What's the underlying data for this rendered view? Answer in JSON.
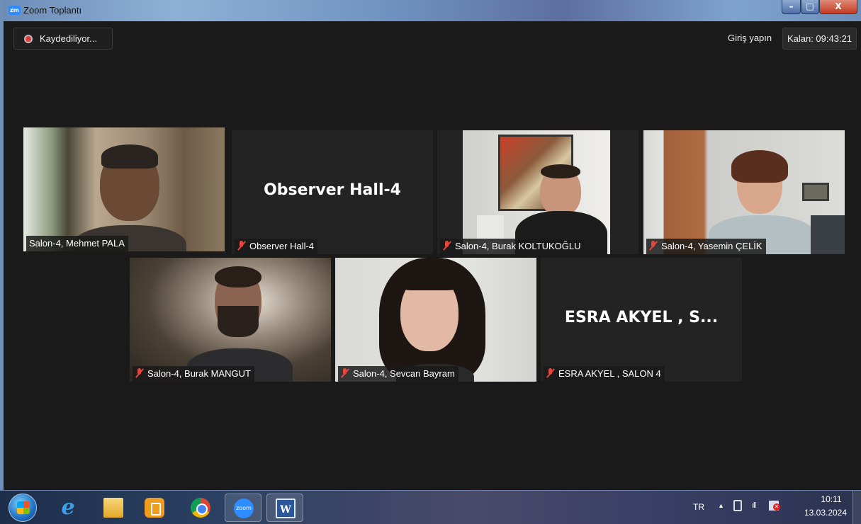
{
  "window": {
    "title": "Zoom Toplantı",
    "app_icon_text": "zm",
    "controls": {
      "min": "–",
      "max": "□",
      "close": "X"
    }
  },
  "toolbar": {
    "recording_label": "Kaydediliyor...",
    "signin_label": "Giriş yapın",
    "timer_label": "Kalan: 09:43:21"
  },
  "participants": [
    {
      "name": "Salon-4, Mehmet PALA",
      "video": true,
      "muted": false,
      "active_speaker": true
    },
    {
      "name": "Observer Hall-4",
      "video": false,
      "muted": true,
      "big_name": "Observer Hall-4"
    },
    {
      "name": "Salon-4, Burak KOLTUKOĞLU",
      "video": true,
      "muted": true
    },
    {
      "name": "Salon-4, Yasemin ÇELİK",
      "video": true,
      "muted": true
    },
    {
      "name": "Salon-4, Burak MANGUT",
      "video": true,
      "muted": true
    },
    {
      "name": "Salon-4, Sevcan Bayram",
      "video": true,
      "muted": true
    },
    {
      "name": "ESRA AKYEL , SALON 4",
      "video": false,
      "muted": true,
      "big_name": "ESRA AKYEL , S..."
    }
  ],
  "taskbar": {
    "apps": [
      "internet-explorer-icon",
      "file-explorer-icon",
      "media-player-icon",
      "chrome-icon",
      "zoom-icon",
      "word-icon"
    ],
    "zoom_label": "zoom",
    "word_label": "W",
    "ie_label": "e",
    "tray": {
      "language": "TR",
      "show_hidden": "▲",
      "signal": "ıll",
      "time": "10:11",
      "date": "13.03.2024"
    }
  },
  "colors": {
    "active_speaker_border": "#c8e55a",
    "muted_icon": "#e8453c",
    "meeting_bg": "#1a1a1a"
  }
}
